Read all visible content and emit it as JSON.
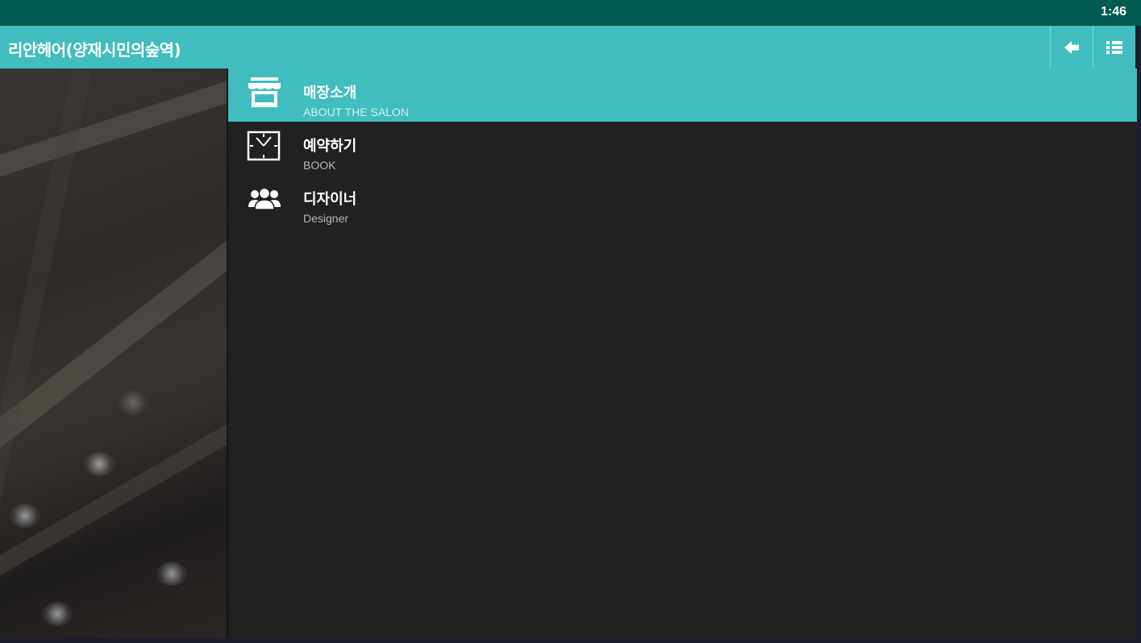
{
  "status_bar": {
    "time": "1:46"
  },
  "app_bar": {
    "title": "리안헤어(양재시민의숲역)",
    "back_icon": "arrow-left-icon",
    "menu_icon": "list-icon",
    "color": "#41bdbf"
  },
  "menu": {
    "items": [
      {
        "title": "매장소개",
        "subtitle": "ABOUT THE SALON",
        "icon": "storefront-icon",
        "active": true
      },
      {
        "title": "예약하기",
        "subtitle": "BOOK",
        "icon": "clock-icon",
        "active": false
      },
      {
        "title": "디자이너",
        "subtitle": "Designer",
        "icon": "people-icon",
        "active": false
      }
    ]
  },
  "colors": {
    "status_bar": "#005a4e",
    "accent": "#41bdbf",
    "drawer_bg": "#212121"
  }
}
